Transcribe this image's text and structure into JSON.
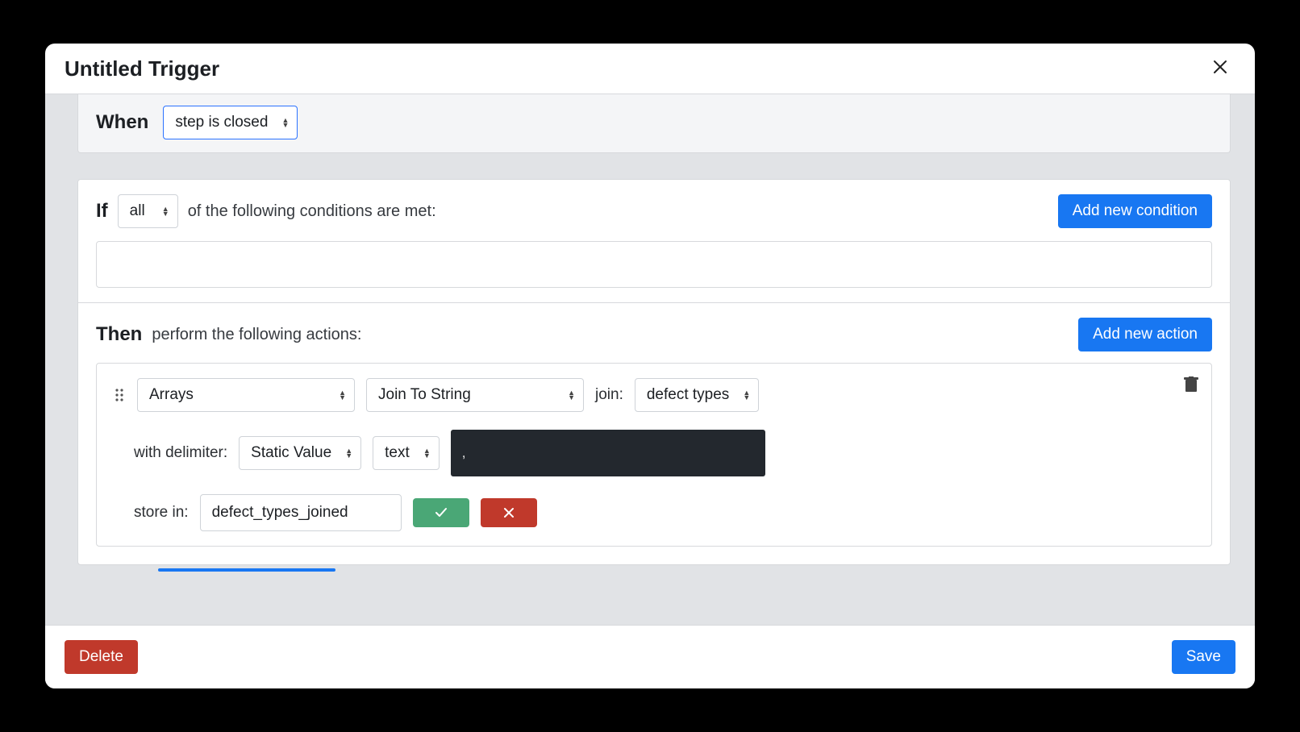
{
  "header": {
    "title": "Untitled Trigger"
  },
  "when": {
    "label": "When",
    "event_selected": "step is closed"
  },
  "if": {
    "label": "If",
    "mode_selected": "all",
    "suffix_text": "of the following conditions are met:",
    "add_button": "Add new condition"
  },
  "then": {
    "label": "Then",
    "suffix_text": "perform the following actions:",
    "add_button": "Add new action",
    "action": {
      "category_selected": "Arrays",
      "operation_selected": "Join To String",
      "join_label": "join:",
      "join_field_selected": "defect types",
      "delimiter_label": "with delimiter:",
      "delimiter_source_selected": "Static Value",
      "delimiter_type_selected": "text",
      "delimiter_value": ",",
      "store_label": "store in:",
      "store_value": "defect_types_joined"
    }
  },
  "footer": {
    "delete": "Delete",
    "save": "Save"
  }
}
